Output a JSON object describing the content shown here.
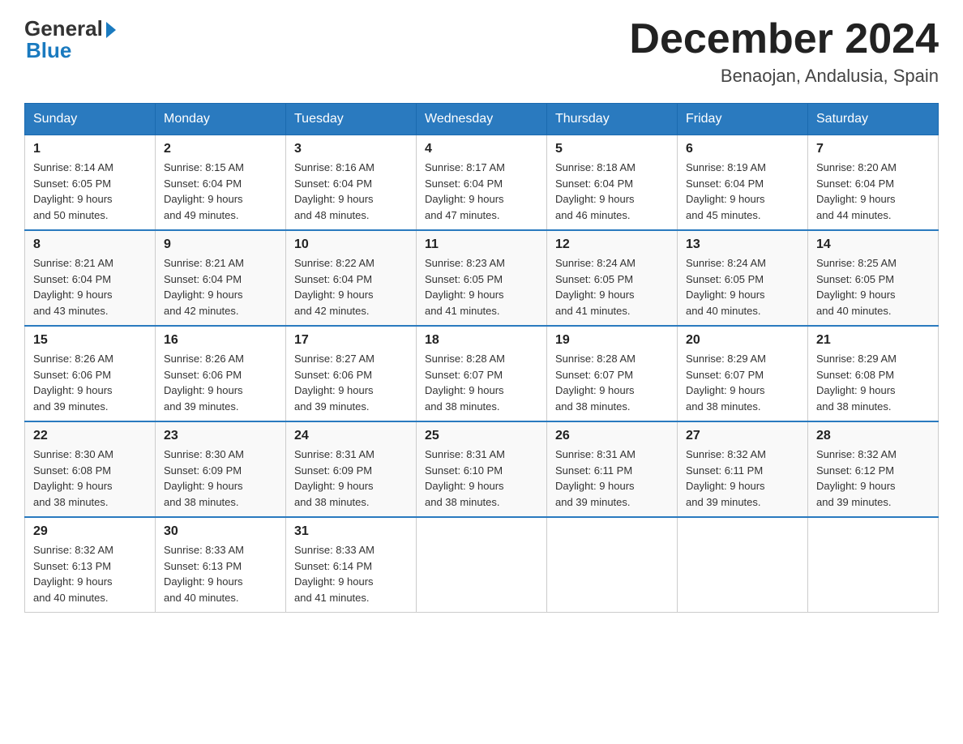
{
  "header": {
    "logo_general": "General",
    "logo_blue": "Blue",
    "month_title": "December 2024",
    "location": "Benaojan, Andalusia, Spain"
  },
  "weekdays": [
    "Sunday",
    "Monday",
    "Tuesday",
    "Wednesday",
    "Thursday",
    "Friday",
    "Saturday"
  ],
  "weeks": [
    [
      {
        "day": "1",
        "sunrise": "8:14 AM",
        "sunset": "6:05 PM",
        "daylight": "9 hours and 50 minutes."
      },
      {
        "day": "2",
        "sunrise": "8:15 AM",
        "sunset": "6:04 PM",
        "daylight": "9 hours and 49 minutes."
      },
      {
        "day": "3",
        "sunrise": "8:16 AM",
        "sunset": "6:04 PM",
        "daylight": "9 hours and 48 minutes."
      },
      {
        "day": "4",
        "sunrise": "8:17 AM",
        "sunset": "6:04 PM",
        "daylight": "9 hours and 47 minutes."
      },
      {
        "day": "5",
        "sunrise": "8:18 AM",
        "sunset": "6:04 PM",
        "daylight": "9 hours and 46 minutes."
      },
      {
        "day": "6",
        "sunrise": "8:19 AM",
        "sunset": "6:04 PM",
        "daylight": "9 hours and 45 minutes."
      },
      {
        "day": "7",
        "sunrise": "8:20 AM",
        "sunset": "6:04 PM",
        "daylight": "9 hours and 44 minutes."
      }
    ],
    [
      {
        "day": "8",
        "sunrise": "8:21 AM",
        "sunset": "6:04 PM",
        "daylight": "9 hours and 43 minutes."
      },
      {
        "day": "9",
        "sunrise": "8:21 AM",
        "sunset": "6:04 PM",
        "daylight": "9 hours and 42 minutes."
      },
      {
        "day": "10",
        "sunrise": "8:22 AM",
        "sunset": "6:04 PM",
        "daylight": "9 hours and 42 minutes."
      },
      {
        "day": "11",
        "sunrise": "8:23 AM",
        "sunset": "6:05 PM",
        "daylight": "9 hours and 41 minutes."
      },
      {
        "day": "12",
        "sunrise": "8:24 AM",
        "sunset": "6:05 PM",
        "daylight": "9 hours and 41 minutes."
      },
      {
        "day": "13",
        "sunrise": "8:24 AM",
        "sunset": "6:05 PM",
        "daylight": "9 hours and 40 minutes."
      },
      {
        "day": "14",
        "sunrise": "8:25 AM",
        "sunset": "6:05 PM",
        "daylight": "9 hours and 40 minutes."
      }
    ],
    [
      {
        "day": "15",
        "sunrise": "8:26 AM",
        "sunset": "6:06 PM",
        "daylight": "9 hours and 39 minutes."
      },
      {
        "day": "16",
        "sunrise": "8:26 AM",
        "sunset": "6:06 PM",
        "daylight": "9 hours and 39 minutes."
      },
      {
        "day": "17",
        "sunrise": "8:27 AM",
        "sunset": "6:06 PM",
        "daylight": "9 hours and 39 minutes."
      },
      {
        "day": "18",
        "sunrise": "8:28 AM",
        "sunset": "6:07 PM",
        "daylight": "9 hours and 38 minutes."
      },
      {
        "day": "19",
        "sunrise": "8:28 AM",
        "sunset": "6:07 PM",
        "daylight": "9 hours and 38 minutes."
      },
      {
        "day": "20",
        "sunrise": "8:29 AM",
        "sunset": "6:07 PM",
        "daylight": "9 hours and 38 minutes."
      },
      {
        "day": "21",
        "sunrise": "8:29 AM",
        "sunset": "6:08 PM",
        "daylight": "9 hours and 38 minutes."
      }
    ],
    [
      {
        "day": "22",
        "sunrise": "8:30 AM",
        "sunset": "6:08 PM",
        "daylight": "9 hours and 38 minutes."
      },
      {
        "day": "23",
        "sunrise": "8:30 AM",
        "sunset": "6:09 PM",
        "daylight": "9 hours and 38 minutes."
      },
      {
        "day": "24",
        "sunrise": "8:31 AM",
        "sunset": "6:09 PM",
        "daylight": "9 hours and 38 minutes."
      },
      {
        "day": "25",
        "sunrise": "8:31 AM",
        "sunset": "6:10 PM",
        "daylight": "9 hours and 38 minutes."
      },
      {
        "day": "26",
        "sunrise": "8:31 AM",
        "sunset": "6:11 PM",
        "daylight": "9 hours and 39 minutes."
      },
      {
        "day": "27",
        "sunrise": "8:32 AM",
        "sunset": "6:11 PM",
        "daylight": "9 hours and 39 minutes."
      },
      {
        "day": "28",
        "sunrise": "8:32 AM",
        "sunset": "6:12 PM",
        "daylight": "9 hours and 39 minutes."
      }
    ],
    [
      {
        "day": "29",
        "sunrise": "8:32 AM",
        "sunset": "6:13 PM",
        "daylight": "9 hours and 40 minutes."
      },
      {
        "day": "30",
        "sunrise": "8:33 AM",
        "sunset": "6:13 PM",
        "daylight": "9 hours and 40 minutes."
      },
      {
        "day": "31",
        "sunrise": "8:33 AM",
        "sunset": "6:14 PM",
        "daylight": "9 hours and 41 minutes."
      },
      null,
      null,
      null,
      null
    ]
  ],
  "labels": {
    "sunrise": "Sunrise:",
    "sunset": "Sunset:",
    "daylight": "Daylight:"
  }
}
